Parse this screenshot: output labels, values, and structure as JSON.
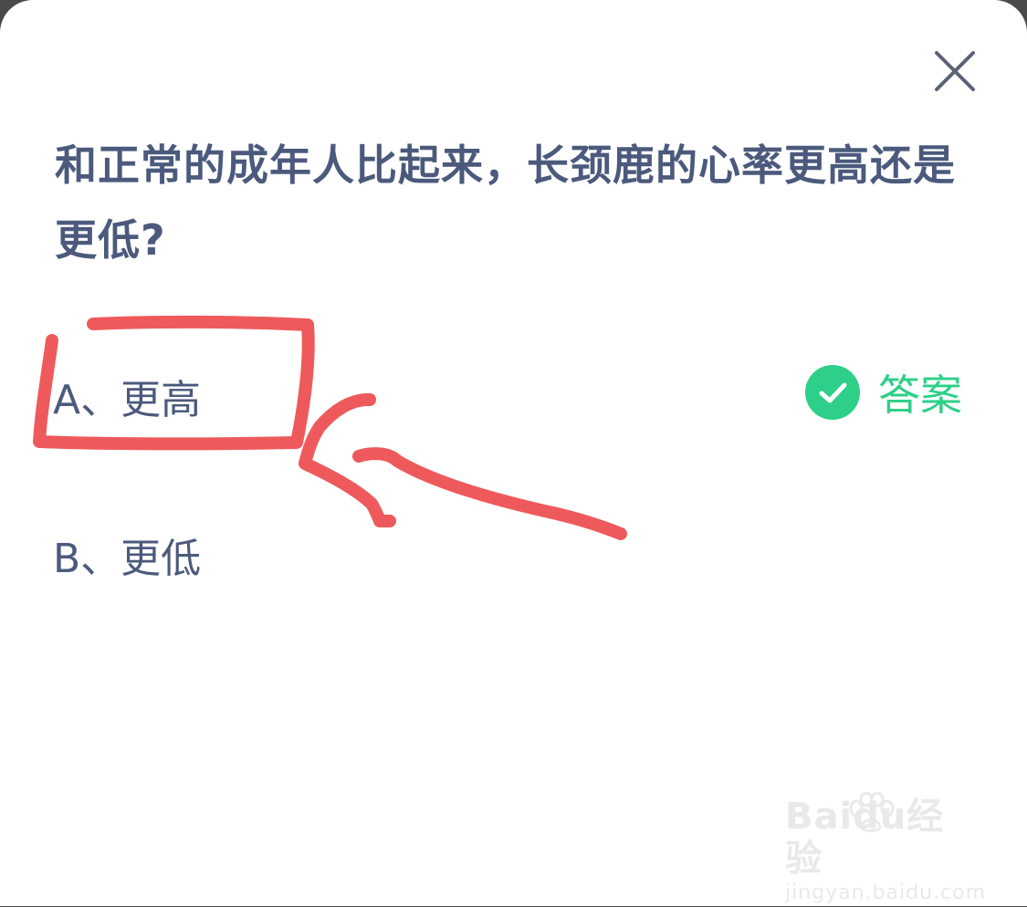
{
  "question": {
    "text": "和正常的成年人比起来，长颈鹿的心率更高还是更低?"
  },
  "options": [
    {
      "label": "A、更高"
    },
    {
      "label": "B、更低"
    }
  ],
  "answer": {
    "label": "答案",
    "icon": "check-circle-icon",
    "color": "#2ecf88"
  },
  "close": {
    "icon": "close-icon"
  },
  "annotation": {
    "color": "#ee5a5c",
    "shapes": [
      "highlight-box",
      "arrow"
    ]
  },
  "watermark": {
    "brand": "Baidu经验",
    "url": "jingyan.baidu.com"
  },
  "colors": {
    "question_text": "#4b5a7c",
    "background": "#ffffff"
  }
}
